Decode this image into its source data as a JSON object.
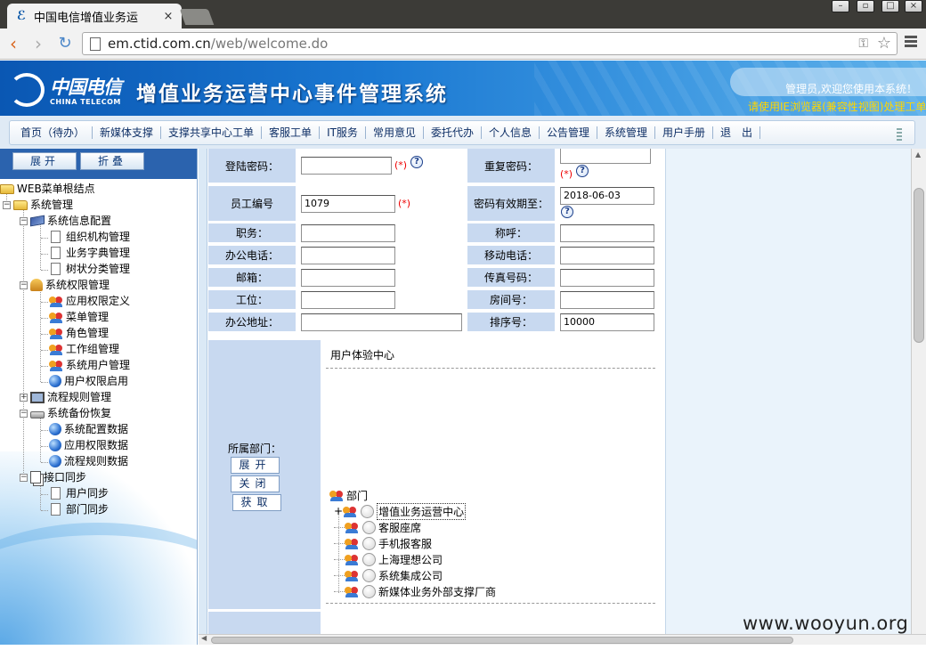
{
  "browser": {
    "tab_title": "中国电信增值业务运",
    "tab_close": "×",
    "url_host": "em.ctid.com.cn",
    "url_path": "/web/welcome.do"
  },
  "header": {
    "logo_cn": "中国电信",
    "logo_en": "CHINA TELECOM",
    "title": "增值业务运营中心事件管理系统",
    "welcome": "管理员,欢迎您使用本系统！",
    "browser_tip": "请使用IE浏览器(兼容性视图)处理工单"
  },
  "nav": {
    "items": [
      "首页（待办）",
      "新媒体支撑",
      "支撑共享中心工单",
      "客服工单",
      "IT服务",
      "常用意见",
      "委托代办",
      "个人信息",
      "公告管理",
      "系统管理",
      "用户手册",
      "退　出"
    ]
  },
  "sidebar": {
    "expand_label": "展开",
    "collapse_label": "折叠",
    "tree": {
      "root": "WEB菜单根结点",
      "system_mgmt": "系统管理",
      "sys_info_config": "系统信息配置",
      "org_mgmt": "组织机构管理",
      "dict_mgmt": "业务字典管理",
      "tree_class_mgmt": "树状分类管理",
      "sys_perm_mgmt": "系统权限管理",
      "app_perm_def": "应用权限定义",
      "menu_mgmt": "菜单管理",
      "role_mgmt": "角色管理",
      "workgroup_mgmt": "工作组管理",
      "sys_user_mgmt": "系统用户管理",
      "user_perm_enable": "用户权限启用",
      "flow_rule_mgmt": "流程规则管理",
      "sys_backup": "系统备份恢复",
      "sys_config_data": "系统配置数据",
      "app_perm_data": "应用权限数据",
      "flow_rule_data": "流程规则数据",
      "iface_sync": "接口同步",
      "user_sync": "用户同步",
      "dept_sync": "部门同步"
    }
  },
  "form": {
    "required_mark": "(*)",
    "help_mark": "?",
    "login_pwd_label": "登陆密码：",
    "login_pwd_value": "",
    "repeat_pwd_label": "重复密码：",
    "repeat_pwd_value": "",
    "emp_no_label": "员工编号",
    "emp_no_value": "1079",
    "pwd_expire_label": "密码有效期至：",
    "pwd_expire_value": "2018-06-03",
    "position_label": "职务：",
    "position_value": "",
    "title_label": "称呼：",
    "title_value": "",
    "office_phone_label": "办公电话：",
    "office_phone_value": "",
    "mobile_label": "移动电话：",
    "mobile_value": "",
    "email_label": "邮箱：",
    "email_value": "",
    "fax_label": "传真号码：",
    "fax_value": "",
    "seat_label": "工位：",
    "seat_value": "",
    "room_label": "房间号：",
    "room_value": "",
    "address_label": "办公地址：",
    "address_value": "",
    "sort_label": "排序号：",
    "sort_value": "10000"
  },
  "dept": {
    "label": "所属部门：",
    "btn_expand": "展开",
    "btn_close": "关闭",
    "btn_fetch": "获取",
    "selected": "用户体验中心",
    "tree_root": "部门",
    "nodes": [
      "增值业务运营中心",
      "客服座席",
      "手机报客服",
      "上海理想公司",
      "系统集成公司",
      "新媒体业务外部支撑厂商"
    ]
  },
  "watermark": "www.wooyun.org"
}
